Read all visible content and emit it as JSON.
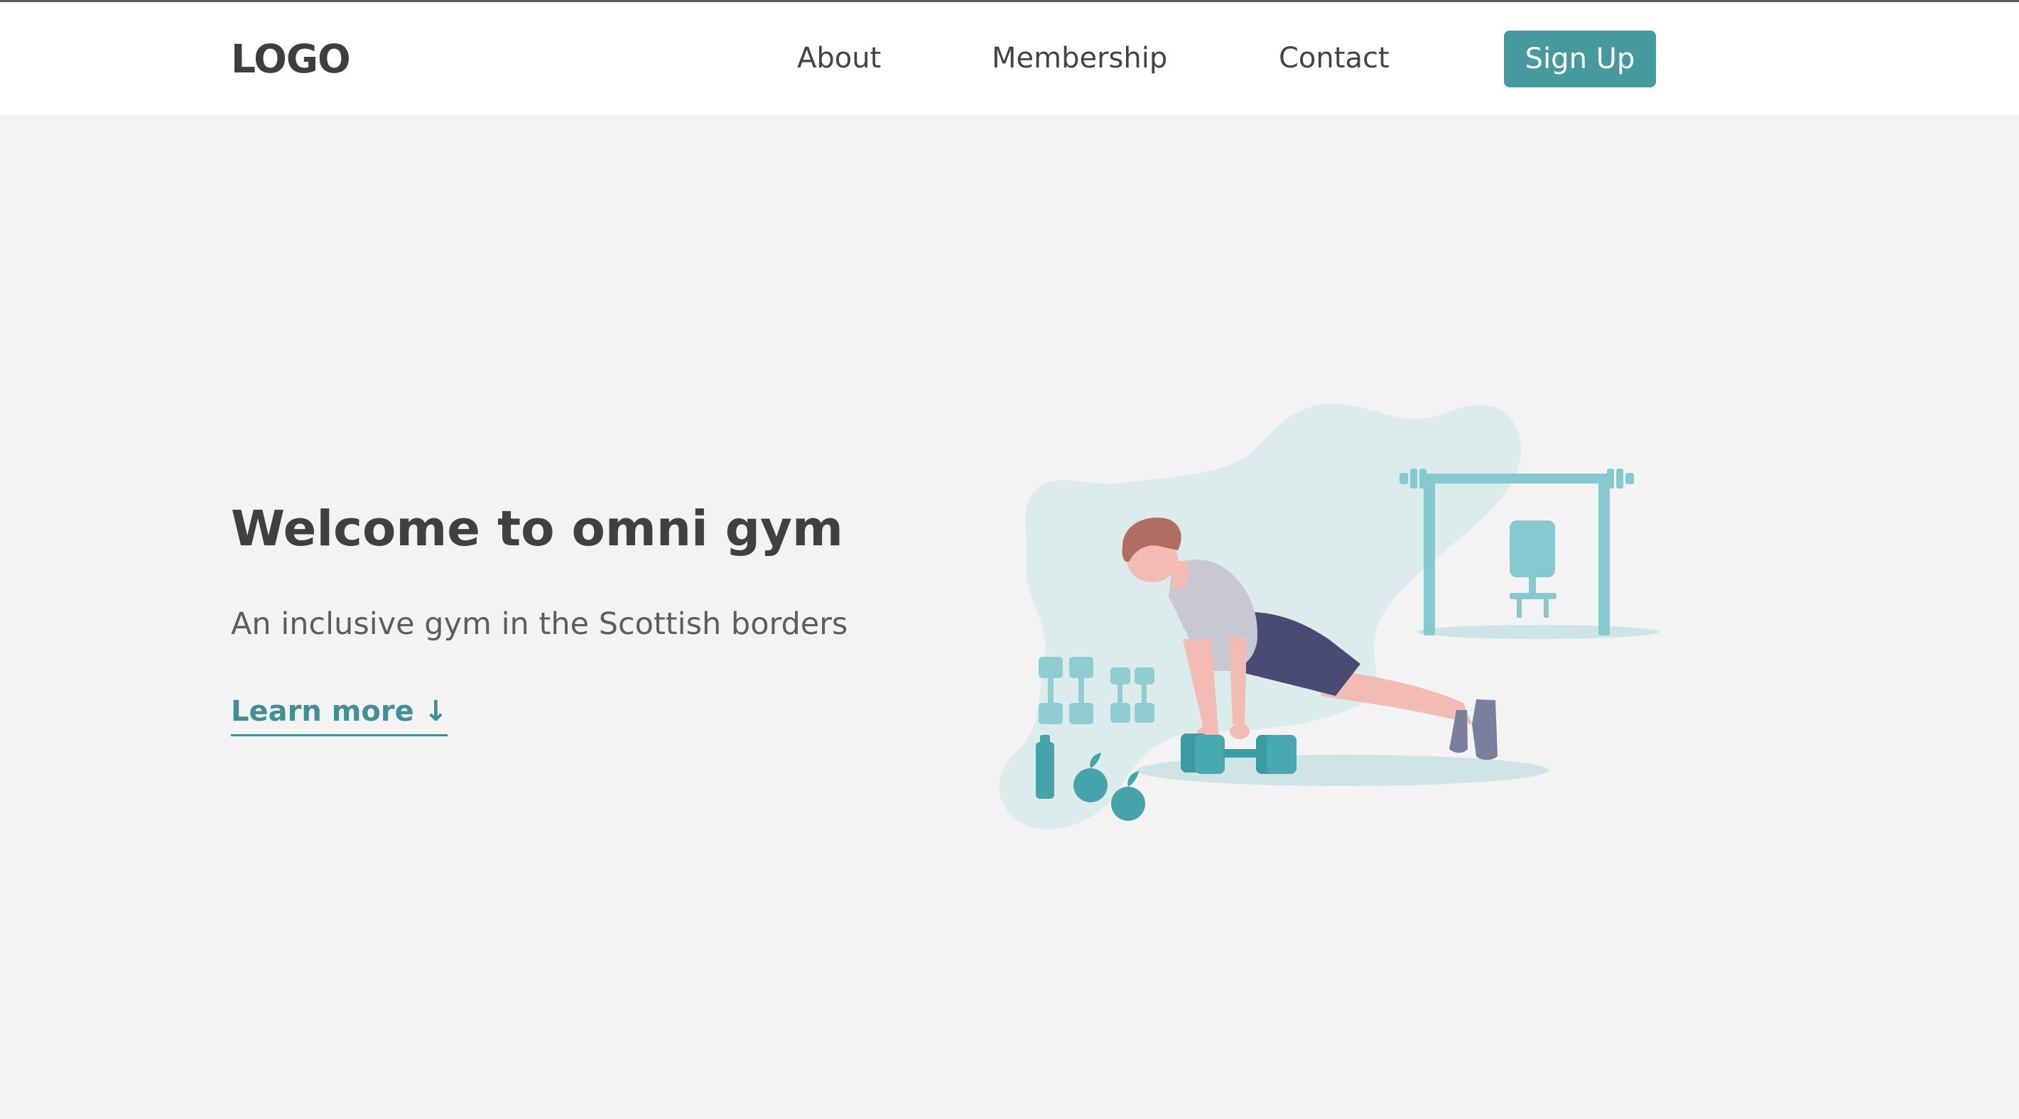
{
  "header": {
    "logo": "LOGO",
    "nav": {
      "about": "About",
      "membership": "Membership",
      "contact": "Contact"
    },
    "signup_label": "Sign Up"
  },
  "hero": {
    "title": "Welcome to omni gym",
    "subtitle": "An inclusive gym in the Scottish borders",
    "cta_label": "Learn more ↓"
  },
  "colors": {
    "accent": "#46999d",
    "text_dark": "#404040",
    "background": "#f3f3f3",
    "illustration_teal": "#8acbd0",
    "illustration_blob": "#dcebec"
  },
  "illustration": {
    "icon": "push-up-illustration"
  }
}
